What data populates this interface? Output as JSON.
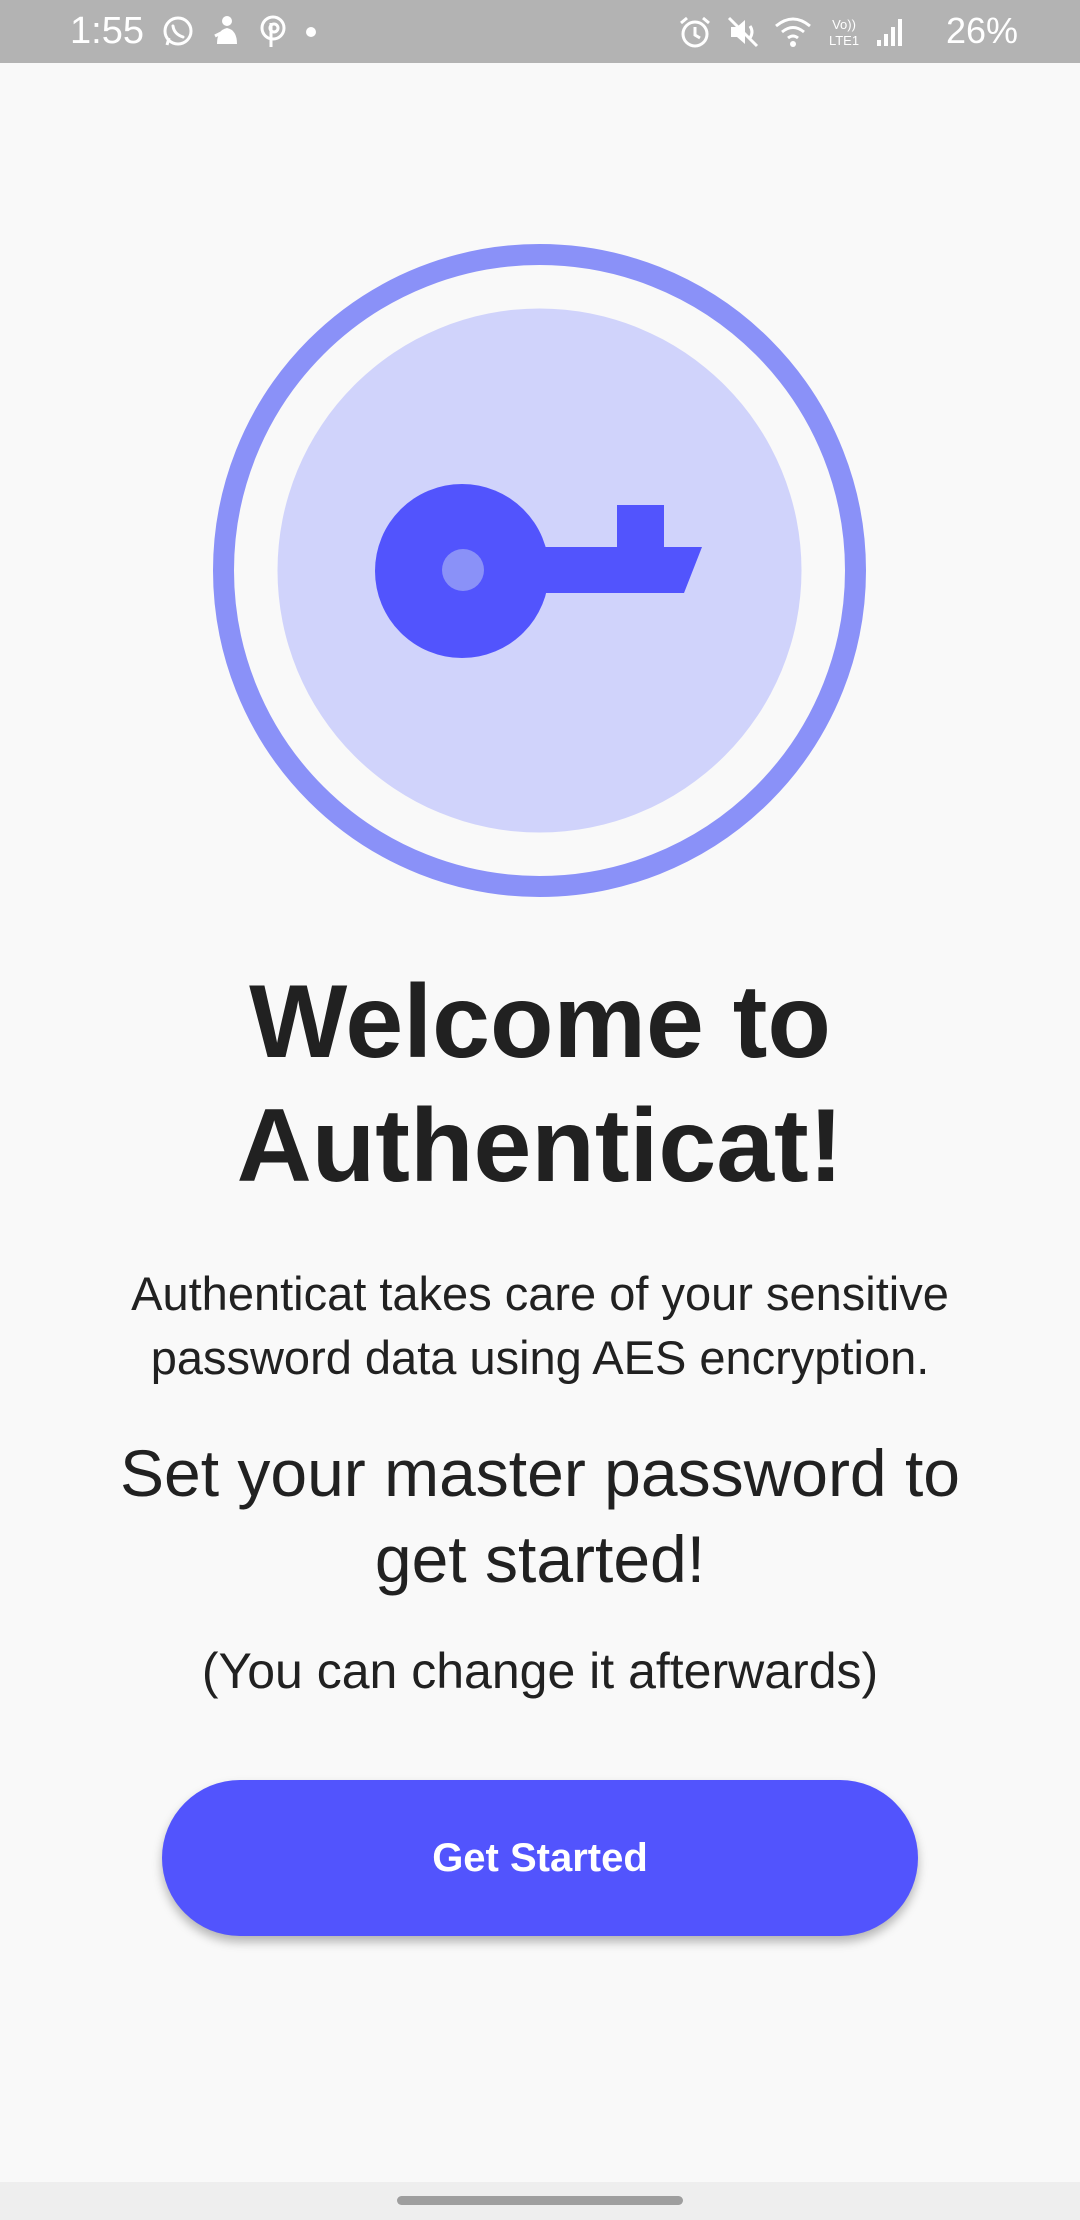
{
  "status_bar": {
    "time": "1:55",
    "battery_percent": "26%",
    "left_icons": [
      "whatsapp-icon",
      "notification-app-icon",
      "pinterest-icon",
      "dot-icon"
    ],
    "right_icons": [
      "alarm-icon",
      "mute-icon",
      "wifi-icon",
      "volte-lte-icon",
      "signal-icon",
      "battery-charging-icon"
    ],
    "volte_label": "Vo))\nLTE1"
  },
  "hero": {
    "icon": "key-icon",
    "outer_ring_color": "#8a91f8",
    "inner_circle_color": "#d0d3fb",
    "key_color": "#5254fd",
    "key_hole_color": "#8a91f8"
  },
  "welcome": {
    "title_line1": "Welcome to",
    "title_line2": "Authenticat!",
    "description_line1": "Authenticat takes care of your sensitive",
    "description_line2": "password data using AES encryption.",
    "cta_line1": "Set your master password to",
    "cta_line2": "get started!",
    "note": "(You can change it afterwards)"
  },
  "actions": {
    "get_started_label": "Get Started",
    "accent_color": "#5254fd"
  }
}
